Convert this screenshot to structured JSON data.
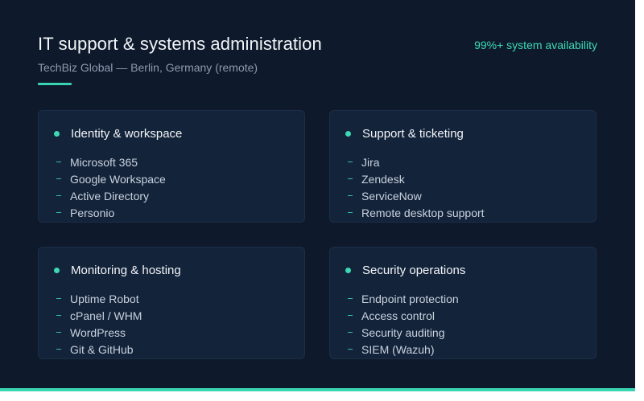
{
  "header": {
    "title": "IT support & systems administration",
    "subtitle": "TechBiz Global — Berlin, Germany (remote)",
    "availability": "99%+ system availability"
  },
  "cards": [
    {
      "title": "Identity & workspace",
      "items": [
        "Microsoft 365",
        "Google Workspace",
        "Active Directory",
        "Personio"
      ]
    },
    {
      "title": "Support & ticketing",
      "items": [
        "Jira",
        "Zendesk",
        "ServiceNow",
        "Remote desktop support"
      ]
    },
    {
      "title": "Monitoring & hosting",
      "items": [
        "Uptime Robot",
        "cPanel / WHM",
        "WordPress",
        "Git & GitHub"
      ]
    },
    {
      "title": "Security operations",
      "items": [
        "Endpoint protection",
        "Access control",
        "Security auditing",
        "SIEM (Wazuh)"
      ]
    }
  ],
  "colors": {
    "background": "#0e1a2b",
    "card": "#13233a",
    "accent": "#3dd9b4"
  }
}
